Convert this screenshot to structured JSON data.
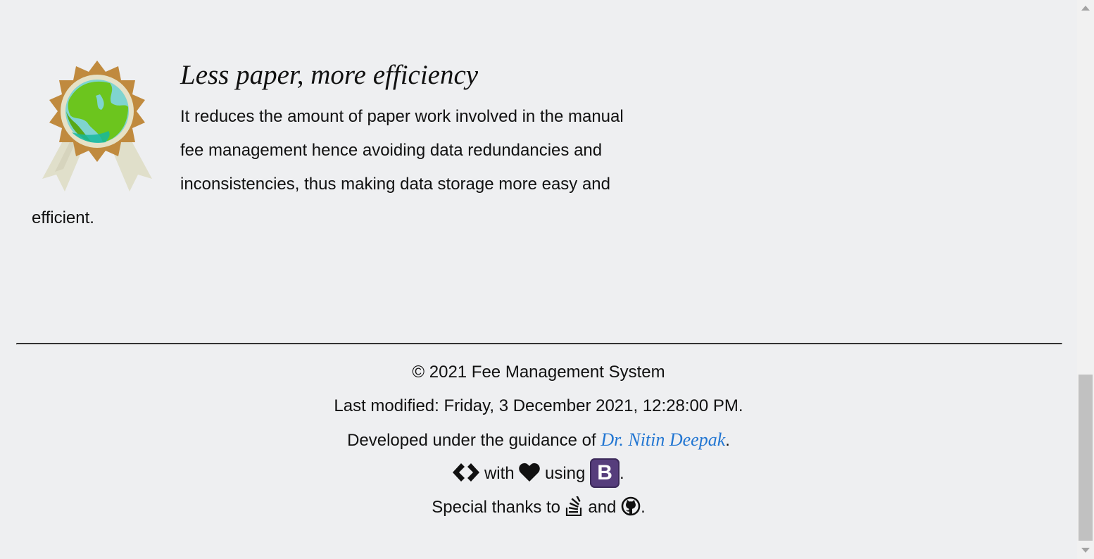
{
  "feature": {
    "title": "Less paper, more efficiency",
    "lines": [
      "It reduces the amount of paper work involved in the manual",
      "fee management hence avoiding data redundancies and",
      "inconsistencies, thus making data storage more easy and"
    ],
    "tail": "efficient.",
    "icon": "award-badge-globe-icon"
  },
  "footer": {
    "copyright": "© 2021 Fee Management System",
    "last_modified": "Last modified: Friday, 3 December 2021, 12:28:00 PM.",
    "guidance_prefix": "Developed under the guidance of ",
    "guidance_link": "Dr. Nitin Deepak",
    "guidance_suffix": ".",
    "built_with": "with",
    "built_using": "using",
    "built_suffix": ".",
    "bootstrap_letter": "B",
    "thanks_prefix": "Special thanks to",
    "thanks_and": "and",
    "thanks_suffix": ".",
    "icons": [
      "code-icon",
      "heart-icon",
      "bootstrap-icon",
      "stack-overflow-icon",
      "github-icon"
    ]
  },
  "colors": {
    "background": "#eeeff1",
    "link": "#2276d2",
    "bootstrap": "#563d7c",
    "badge_ring": "#c08a3e",
    "globe_land": "#6cc51e",
    "globe_water": "#7fd4d0",
    "ribbon": "#e0dfca"
  }
}
